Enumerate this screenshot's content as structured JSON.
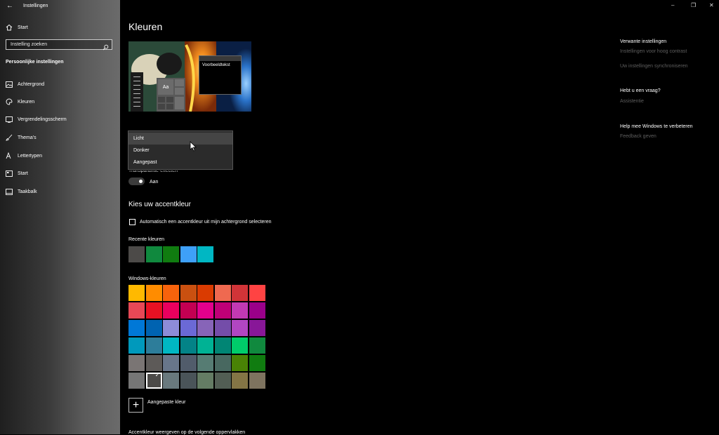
{
  "app": {
    "title": "Instellingen"
  },
  "sidebar": {
    "home_label": "Start",
    "search_placeholder": "Instelling zoeken",
    "section_heading": "Persoonlijke instellingen",
    "items": [
      {
        "label": "Achtergrond",
        "icon": "picture-icon"
      },
      {
        "label": "Kleuren",
        "icon": "palette-icon"
      },
      {
        "label": "Vergrendelingsscherm",
        "icon": "lock-screen-icon"
      },
      {
        "label": "Thema's",
        "icon": "brush-icon"
      },
      {
        "label": "Lettertypen",
        "icon": "font-icon"
      },
      {
        "label": "Start",
        "icon": "start-icon"
      },
      {
        "label": "Taakbalk",
        "icon": "taskbar-icon"
      }
    ]
  },
  "main": {
    "title": "Kleuren",
    "preview": {
      "sample_text": "Voorbeeldtekst",
      "tile_text": "Aa"
    },
    "mode_dropdown": {
      "options": [
        "Licht",
        "Donker",
        "Aangepast"
      ],
      "hovered": "Licht"
    },
    "transparency": {
      "label": "Transparantie-effecten",
      "state": "Aan"
    },
    "accent_heading": "Kies uw accentkleur",
    "auto_accent_label": "Automatisch een accentkleur uit mijn achtergrond selecteren",
    "recent_label": "Recente kleuren",
    "recent_colors": [
      "#4c4a48",
      "#10893e",
      "#107c10",
      "#3ea0f9",
      "#00b7c3"
    ],
    "windows_label": "Windows-kleuren",
    "windows_colors": [
      [
        "#ffb900",
        "#ff8c00",
        "#f7630c",
        "#ca5010",
        "#da3b01",
        "#ef6950",
        "#d13438",
        "#ff4343"
      ],
      [
        "#e74856",
        "#e81123",
        "#ea005e",
        "#c30052",
        "#e3008c",
        "#bf0077",
        "#c239b3",
        "#9a0089"
      ],
      [
        "#0078d7",
        "#0063b1",
        "#8e8cd8",
        "#6b69d6",
        "#8764b8",
        "#744da9",
        "#b146c2",
        "#881798"
      ],
      [
        "#0099bc",
        "#2d7d9a",
        "#00b7c3",
        "#038387",
        "#00b294",
        "#018574",
        "#00cc6a",
        "#10893e"
      ],
      [
        "#7a7574",
        "#5d5a58",
        "#68768a",
        "#515c6b",
        "#567c73",
        "#486860",
        "#498205",
        "#107c10"
      ],
      [
        "#767676",
        "#4c4a48",
        "#69797e",
        "#4a5459",
        "#647c64",
        "#525e54",
        "#847545",
        "#7e735f"
      ]
    ],
    "selected_color": "#4c4a48",
    "custom_color_label": "Aangepaste kleur",
    "bottom_heading": "Accentkleur weergeven op de volgende oppervlakken"
  },
  "related": {
    "heading": "Verwante instellingen",
    "links": [
      "Instellingen voor hoog contrast",
      "Uw instellingen synchroniseren"
    ],
    "question_heading": "Hebt u een vraag?",
    "question_link": "Assistentie",
    "improve_heading": "Help mee Windows te verbeteren",
    "improve_link": "Feedback geven"
  }
}
